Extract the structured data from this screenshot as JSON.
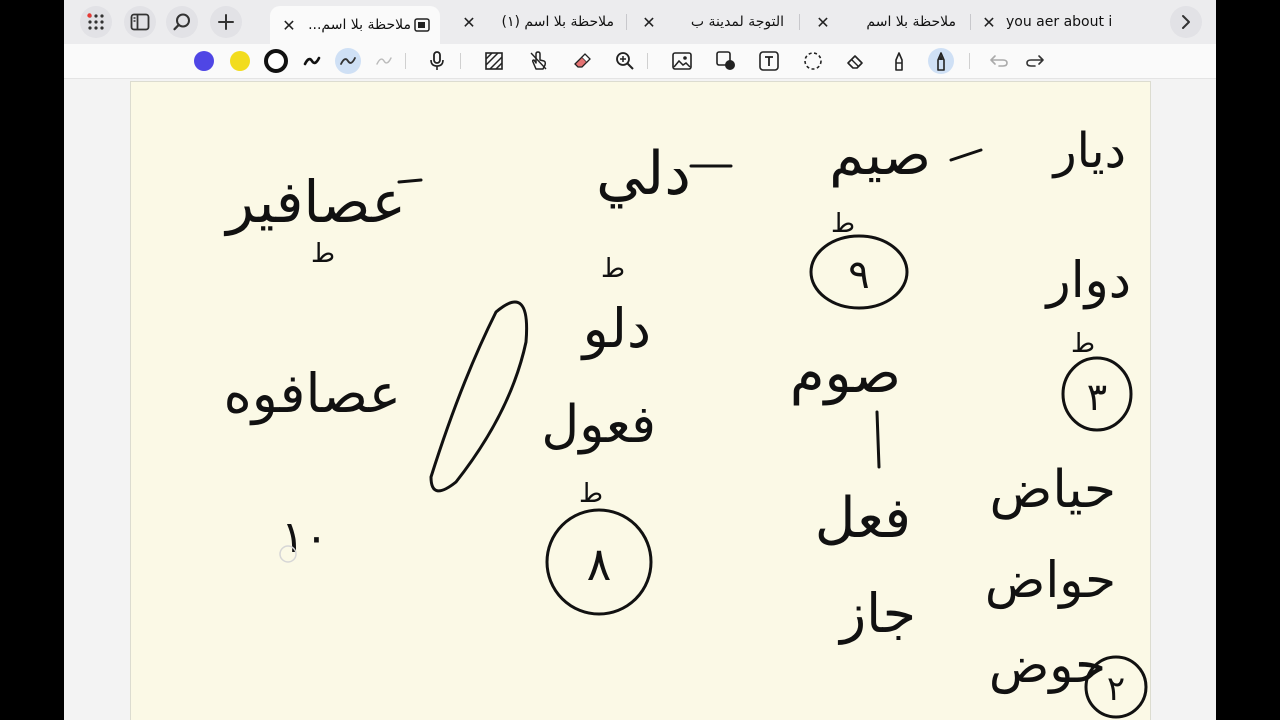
{
  "browser": {
    "tabs": [
      {
        "title": "ملاحظة بلا اسم...",
        "active": true
      },
      {
        "title": "ملاحظة بلا اسم (١)",
        "active": false
      },
      {
        "title": "التوجة لمدينة ب",
        "active": false
      },
      {
        "title": "ملاحظة بلا اسم",
        "active": false
      },
      {
        "title": "you aer about i",
        "active": false
      }
    ]
  },
  "toolbar": {
    "colors": {
      "blue": "#4f46e5",
      "yellow": "#f2dc1d",
      "black": "#111111"
    },
    "tools": [
      "lasso-pen-icon",
      "wave-pen-icon",
      "faded-pen-icon",
      "microphone-icon",
      "hatch-icon",
      "touch-icon",
      "eraser-icon",
      "zoom-in-icon",
      "image-icon",
      "shape-icon",
      "text-box-icon",
      "lasso-select-icon",
      "eraser-outline-icon",
      "highlighter-icon",
      "pen-icon",
      "undo-icon",
      "redo-icon"
    ]
  },
  "note": {
    "background": "#fbf9e6",
    "words": {
      "row1": [
        "عصافير",
        "دلي",
        "صيم",
        "ديار"
      ],
      "row2": [
        "عصافوه",
        "دلو",
        "صوم",
        "دوار"
      ],
      "row3_left": "فعول",
      "row3_right": [
        "فعل",
        "حياض"
      ],
      "row4": [
        "جاز",
        "حواض",
        "حوض"
      ]
    },
    "circled_numbers": [
      "٩",
      "٣",
      "٨",
      "٢"
    ],
    "plain_number": "١٠",
    "marks": [
      "ط",
      "ط",
      "ط",
      "ط",
      "ط"
    ]
  }
}
